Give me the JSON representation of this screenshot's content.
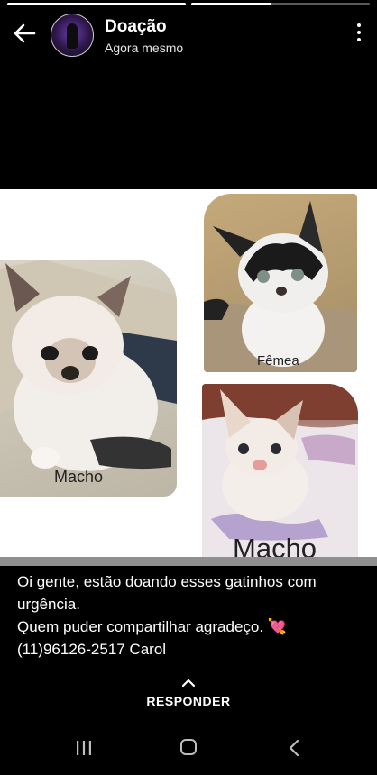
{
  "story": {
    "progress": [
      1,
      0.45
    ]
  },
  "header": {
    "title": "Doação",
    "subtitle": "Agora mesmo"
  },
  "photo": {
    "labels": [
      "Fêmea",
      "Macho",
      "Macho"
    ]
  },
  "caption": {
    "lines": [
      "Oi gente, estão doando esses gatinhos com",
      "urgência.",
      "Quem puder compartilhar agradeço.",
      "(11)96126-2517 Carol"
    ],
    "emoji": "💘"
  },
  "reply": {
    "label": "RESPONDER"
  }
}
